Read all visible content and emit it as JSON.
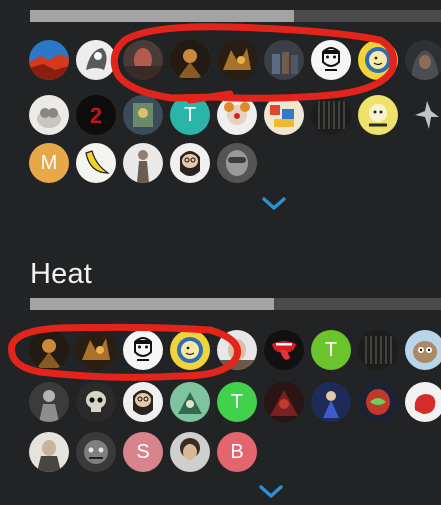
{
  "sections": [
    {
      "name": "",
      "progress": 0.66
    },
    {
      "name": "Heat",
      "progress": 0.55
    }
  ],
  "letters": {
    "m": "M",
    "t": "T",
    "s": "S",
    "b": "B"
  },
  "colors": {
    "background": "#222324",
    "accent_chevron": "#2f8fd6",
    "annotation_red": "#e3241b",
    "avatar_orange": "#e8a84a",
    "avatar_green": "#6cc42c",
    "avatar_teal": "#2bb5a8",
    "avatar_bright_green": "#42d14a",
    "avatar_pink": "#d9848c",
    "avatar_rose": "#e3656e"
  },
  "icons": [
    "chevron-down-icon"
  ]
}
